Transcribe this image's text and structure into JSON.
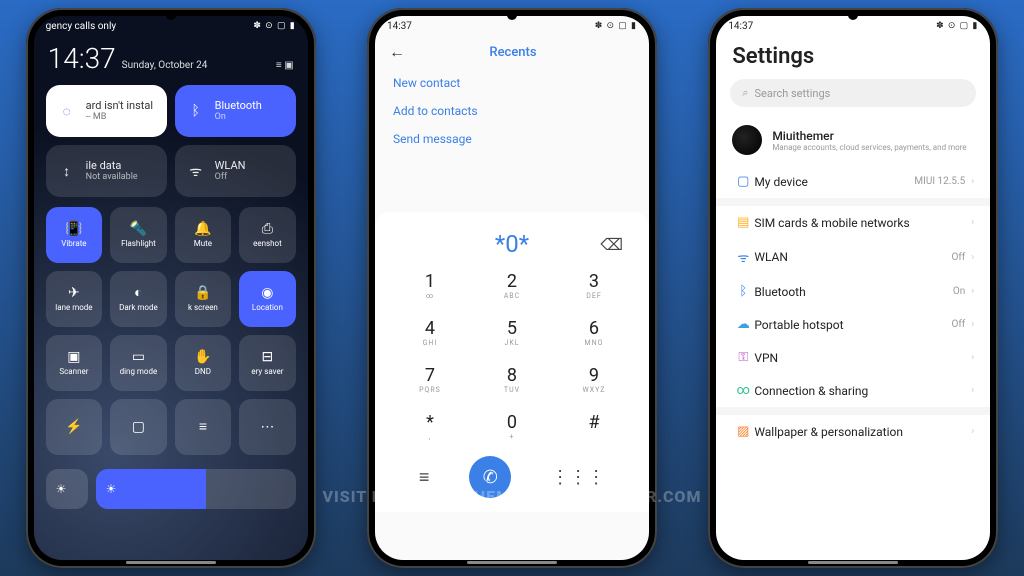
{
  "statusbar": {
    "time": "14:37",
    "icons": "✽ ⊙ ▢ ▮"
  },
  "phone1": {
    "carrier": "gency calls only",
    "clock": "14:37",
    "date": "Sunday, October 24",
    "tiles": {
      "data": {
        "title": "ard isn't instal",
        "sub": "-- MB"
      },
      "bluetooth": {
        "title": "Bluetooth",
        "sub": "On"
      },
      "mobile": {
        "title": "ile data",
        "sub": "Not available"
      },
      "wlan": {
        "title": "WLAN",
        "sub": "Off"
      }
    },
    "small": [
      {
        "icon": "📳",
        "label": "Vibrate",
        "name": "vibrate-toggle",
        "on": true
      },
      {
        "icon": "🔦",
        "label": "Flashlight",
        "name": "flashlight-toggle",
        "on": false
      },
      {
        "icon": "🔔",
        "label": "Mute",
        "name": "mute-toggle",
        "on": false
      },
      {
        "icon": "⎙",
        "label": "eenshot",
        "name": "screenshot-toggle",
        "on": false
      },
      {
        "icon": "✈",
        "label": "lane mode",
        "name": "airplane-toggle",
        "on": false
      },
      {
        "icon": "◐",
        "label": "Dark mode",
        "name": "darkmode-toggle",
        "on": false
      },
      {
        "icon": "🔒",
        "label": "k screen",
        "name": "lockscreen-toggle",
        "on": false
      },
      {
        "icon": "◉",
        "label": "Location",
        "name": "location-toggle",
        "on": true
      },
      {
        "icon": "▣",
        "label": "Scanner",
        "name": "scanner-toggle",
        "on": false
      },
      {
        "icon": "▭",
        "label": "ding mode",
        "name": "reading-toggle",
        "on": false
      },
      {
        "icon": "✋",
        "label": "DND",
        "name": "dnd-toggle",
        "on": false
      },
      {
        "icon": "⊟",
        "label": "ery saver",
        "name": "battery-toggle",
        "on": false
      },
      {
        "icon": "⚡",
        "label": "",
        "name": "quick-toggle-a",
        "on": false
      },
      {
        "icon": "▢",
        "label": "",
        "name": "quick-toggle-b",
        "on": false
      },
      {
        "icon": "≡",
        "label": "",
        "name": "quick-toggle-c",
        "on": false
      },
      {
        "icon": "⋯",
        "label": "",
        "name": "quick-toggle-d",
        "on": false
      }
    ]
  },
  "phone2": {
    "tab": "Recents",
    "actions": {
      "new": "New contact",
      "add": "Add to contacts",
      "send": "Send message"
    },
    "dialed": "*0*",
    "keys": [
      {
        "n": "1",
        "s": "∞"
      },
      {
        "n": "2",
        "s": "ABC"
      },
      {
        "n": "3",
        "s": "DEF"
      },
      {
        "n": "4",
        "s": "GHI"
      },
      {
        "n": "5",
        "s": "JKL"
      },
      {
        "n": "6",
        "s": "MNO"
      },
      {
        "n": "7",
        "s": "PQRS"
      },
      {
        "n": "8",
        "s": "TUV"
      },
      {
        "n": "9",
        "s": "WXYZ"
      },
      {
        "n": "*",
        "s": ","
      },
      {
        "n": "0",
        "s": "+"
      },
      {
        "n": "#",
        "s": ""
      }
    ]
  },
  "phone3": {
    "title": "Settings",
    "search_placeholder": "Search settings",
    "account": {
      "name": "Miuithemer",
      "sub": "Manage accounts, cloud services, payments, and more"
    },
    "items": [
      {
        "name": "my-device",
        "icon": "▢",
        "cls": "dev",
        "label": "My device",
        "val": "MIUI 12.5.5"
      },
      {
        "name": "sim",
        "icon": "▤",
        "cls": "sim",
        "label": "SIM cards & mobile networks",
        "val": ""
      },
      {
        "name": "wlan",
        "icon": "ᯤ",
        "cls": "wifi",
        "label": "WLAN",
        "val": "Off"
      },
      {
        "name": "bluetooth",
        "icon": "ᛒ",
        "cls": "bt",
        "label": "Bluetooth",
        "val": "On"
      },
      {
        "name": "hotspot",
        "icon": "☁",
        "cls": "hot",
        "label": "Portable hotspot",
        "val": "Off"
      },
      {
        "name": "vpn",
        "icon": "⚿",
        "cls": "vpn",
        "label": "VPN",
        "val": ""
      },
      {
        "name": "connection",
        "icon": "∞",
        "cls": "conn",
        "label": "Connection & sharing",
        "val": ""
      },
      {
        "name": "wallpaper",
        "icon": "▨",
        "cls": "wp",
        "label": "Wallpaper & personalization",
        "val": ""
      }
    ]
  },
  "watermark": "VISIT FOR MORE THEMES - MIUITHEMER.COM"
}
